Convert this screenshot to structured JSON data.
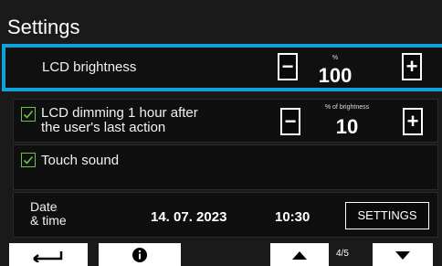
{
  "header": {
    "title": "Settings"
  },
  "brightness": {
    "label": "LCD brightness",
    "unit": "%",
    "value": "100",
    "minus": "−",
    "plus": "+"
  },
  "dimming": {
    "label_line1": "LCD dimming 1 hour after",
    "label_line2": "the user's last action",
    "unit": "% of brightness",
    "value": "10",
    "minus": "−",
    "plus": "+",
    "checked": true
  },
  "touch_sound": {
    "label": "Touch sound",
    "checked": true
  },
  "datetime": {
    "label_line1": "Date",
    "label_line2": "& time",
    "date": "14. 07. 2023",
    "time": "10:30",
    "settings_label": "SETTINGS"
  },
  "nav": {
    "back_icon": "return-arrow-icon",
    "info_icon": "info-icon",
    "up_icon": "arrow-up-icon",
    "down_icon": "arrow-down-icon",
    "page_indicator": "4/5"
  },
  "colors": {
    "highlight": "#10a1d8",
    "check": "#6cc24a",
    "background": "#1a1a1a"
  }
}
